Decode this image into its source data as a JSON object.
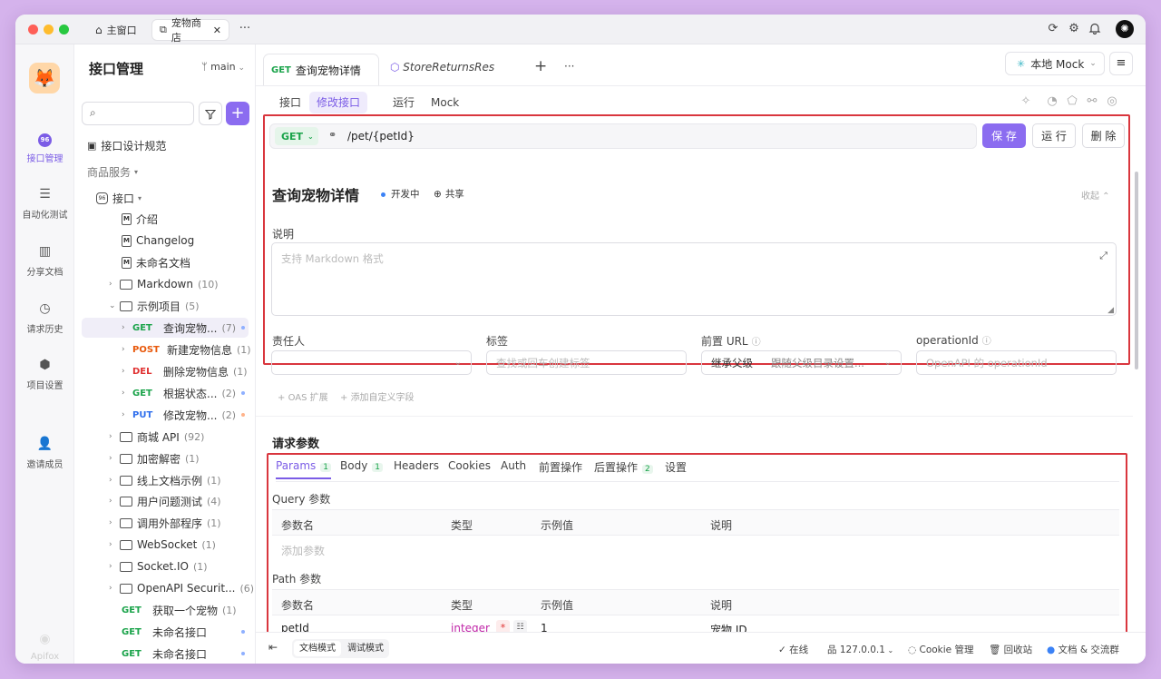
{
  "window_tabs": {
    "home": "主窗口",
    "shop": "宠物商店"
  },
  "rail": [
    {
      "label": "接口管理",
      "icon": "api-icon"
    },
    {
      "label": "自动化测试",
      "icon": "automation-icon"
    },
    {
      "label": "分享文档",
      "icon": "book-icon"
    },
    {
      "label": "请求历史",
      "icon": "history-icon"
    },
    {
      "label": "项目设置",
      "icon": "settings-icon"
    },
    {
      "label": "邀请成员",
      "icon": "invite-icon"
    }
  ],
  "brand": "Apifox",
  "sidebar": {
    "title": "接口管理",
    "branch": "main",
    "search_placeholder": "",
    "design_spec": "接口设计规范",
    "service": "商品服务",
    "root": "接口",
    "items": [
      {
        "label": "介绍"
      },
      {
        "label": "Changelog"
      },
      {
        "label": "未命名文档"
      },
      {
        "label": "Markdown",
        "count": "(10)"
      },
      {
        "label": "示例项目",
        "count": "(5)"
      },
      {
        "method": "GET",
        "label": "查询宠物...",
        "count": "(7)"
      },
      {
        "method": "POST",
        "label": "新建宠物信息",
        "count": "(1)"
      },
      {
        "method": "DEL",
        "label": "删除宠物信息",
        "count": "(1)"
      },
      {
        "method": "GET",
        "label": "根据状态...",
        "count": "(2)"
      },
      {
        "method": "PUT",
        "label": "修改宠物...",
        "count": "(2)"
      },
      {
        "label": "商城 API",
        "count": "(92)"
      },
      {
        "label": "加密解密",
        "count": "(1)"
      },
      {
        "label": "线上文档示例",
        "count": "(1)"
      },
      {
        "label": "用户问题测试",
        "count": "(4)"
      },
      {
        "label": "调用外部程序",
        "count": "(1)"
      },
      {
        "label": "WebSocket",
        "count": "(1)"
      },
      {
        "label": "Socket.IO",
        "count": "(1)"
      },
      {
        "label": "OpenAPI Securit...",
        "count": "(6)"
      },
      {
        "method": "GET",
        "label": "获取一个宠物",
        "count": "(1)"
      },
      {
        "method": "GET",
        "label": "未命名接口"
      },
      {
        "method": "GET",
        "label": "未命名接口"
      }
    ]
  },
  "tabs": {
    "active_method": "GET",
    "active": "查询宠物详情",
    "other": "StoreReturnsRes"
  },
  "env": "本地 Mock",
  "subtabs": [
    "接口",
    "修改接口",
    "运行",
    "Mock"
  ],
  "request": {
    "method": "GET",
    "path": "/pet/{petId}",
    "save": "保 存",
    "run": "运 行",
    "delete": "删 除"
  },
  "api": {
    "title": "查询宠物详情",
    "status": "开发中",
    "share": "共享",
    "collapse": "收起"
  },
  "desc": {
    "label": "说明",
    "placeholder": "支持 Markdown 格式"
  },
  "fields": {
    "owner": "责任人",
    "tags": "标签",
    "tags_placeholder": "查找或回车创建标签",
    "prefix": "前置 URL",
    "prefix_value": "继承父级",
    "prefix_hint": "跟随父级目录设置...",
    "opid": "operationId",
    "opid_placeholder": "OpenAPI 的 operationId"
  },
  "links": {
    "oas": "OAS 扩展",
    "custom": "添加自定义字段"
  },
  "params": {
    "title": "请求参数",
    "tabs": [
      {
        "label": "Params",
        "badge": "1"
      },
      {
        "label": "Body",
        "badge": "1"
      },
      {
        "label": "Headers",
        "badge": ""
      },
      {
        "label": "Cookies",
        "badge": ""
      },
      {
        "label": "Auth",
        "badge": ""
      },
      {
        "label": "前置操作",
        "badge": ""
      },
      {
        "label": "后置操作",
        "badge": "2"
      },
      {
        "label": "设置",
        "badge": ""
      }
    ],
    "query_title": "Query 参数",
    "path_title": "Path 参数",
    "cols": {
      "name": "参数名",
      "type": "类型",
      "example": "示例值",
      "desc": "说明"
    },
    "add_param": "添加参数",
    "path_row": {
      "name": "petId",
      "type": "integer",
      "required": "*",
      "example": "1",
      "desc": "宠物 ID"
    }
  },
  "status": {
    "doc_mode": "文档模式",
    "debug_mode": "调试模式",
    "online": "在线",
    "host": "127.0.0.1",
    "cookie": "Cookie 管理",
    "trash": "回收站",
    "community": "文档 & 交流群"
  },
  "colors": {
    "accent": "#7b5ce6",
    "get": "#1aa34a",
    "post": "#e8590c",
    "del": "#e03131",
    "put": "#2f6fed",
    "highlight": "#d9363e"
  }
}
